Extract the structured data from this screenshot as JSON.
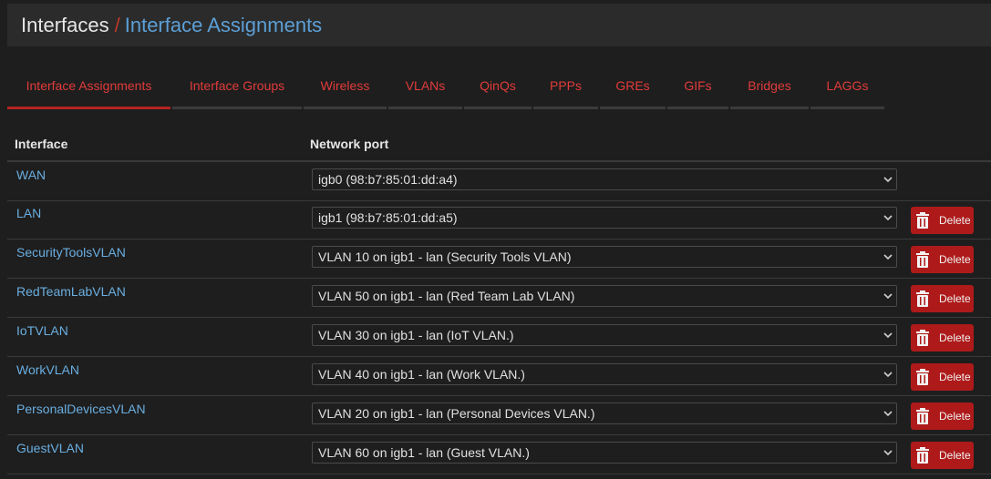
{
  "breadcrumb": {
    "parent": "Interfaces",
    "separator": "/",
    "current": "Interface Assignments"
  },
  "tabs": [
    {
      "label": "Interface Assignments",
      "active": true
    },
    {
      "label": "Interface Groups",
      "active": false
    },
    {
      "label": "Wireless",
      "active": false
    },
    {
      "label": "VLANs",
      "active": false
    },
    {
      "label": "QinQs",
      "active": false
    },
    {
      "label": "PPPs",
      "active": false
    },
    {
      "label": "GREs",
      "active": false
    },
    {
      "label": "GIFs",
      "active": false
    },
    {
      "label": "Bridges",
      "active": false
    },
    {
      "label": "LAGGs",
      "active": false
    }
  ],
  "table": {
    "headers": {
      "interface": "Interface",
      "network_port": "Network port"
    },
    "delete_label": "Delete",
    "rows": [
      {
        "interface": "WAN",
        "port": "igb0 (98:b7:85:01:dd:a4)",
        "deletable": false
      },
      {
        "interface": "LAN",
        "port": "igb1 (98:b7:85:01:dd:a5)",
        "deletable": true
      },
      {
        "interface": "SecurityToolsVLAN",
        "port": "VLAN 10 on igb1 - lan (Security Tools VLAN)",
        "deletable": true
      },
      {
        "interface": "RedTeamLabVLAN",
        "port": "VLAN 50 on igb1 - lan (Red Team Lab VLAN)",
        "deletable": true
      },
      {
        "interface": "IoTVLAN",
        "port": "VLAN 30 on igb1 - lan (IoT VLAN.)",
        "deletable": true
      },
      {
        "interface": "WorkVLAN",
        "port": "VLAN 40 on igb1 - lan (Work VLAN.)",
        "deletable": true
      },
      {
        "interface": "PersonalDevicesVLAN",
        "port": "VLAN 20 on igb1 - lan (Personal Devices VLAN.)",
        "deletable": true
      },
      {
        "interface": "GuestVLAN",
        "port": "VLAN 60 on igb1 - lan (Guest VLAN.)",
        "deletable": true
      }
    ]
  },
  "icons": {
    "dropdown": "chevron-down-icon",
    "delete": "trash-icon"
  },
  "colors": {
    "background": "#1e1e1e",
    "header_bar": "#2b2b2b",
    "tab_text": "#e23b3b",
    "link": "#6aaee0",
    "breadcrumb_current": "#5c9fd6",
    "delete_button": "#ae1a1a"
  }
}
